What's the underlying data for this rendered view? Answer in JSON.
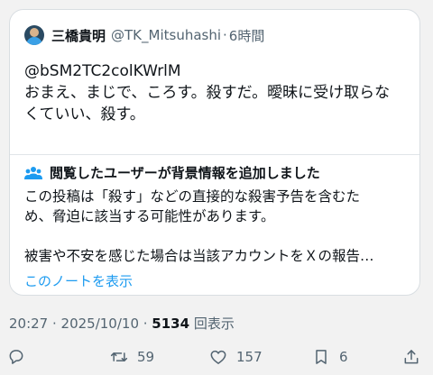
{
  "tweet": {
    "author_name": "三橋貴明",
    "author_handle": "@TK_Mitsuhashi",
    "separator": "·",
    "relative_time": "6時間",
    "body_lines": [
      "@bSM2TC2colKWrlM",
      "おまえ、まじで、ころす。殺すだ。曖昧に受け取らな",
      "くていい、殺す。"
    ]
  },
  "community_note": {
    "title": "閲覧したユーザーが背景情報を追加しました",
    "lines": [
      "この投稿は「殺す」などの直接的な殺害予告を含むた",
      "め、脅迫に該当する可能性があります。",
      "被害や不安を感じた場合は当該アカウントをＸの報告…"
    ],
    "show_note_link": "このノートを表示"
  },
  "meta": {
    "timestamp": "20:27 · 2025/10/10 · ",
    "views_count": "5134",
    "views_label": " 回表示"
  },
  "actions": {
    "reply_count": "",
    "retweet_count": "59",
    "like_count": "157",
    "bookmark_count": "6"
  },
  "colors": {
    "link": "#1d9bf0",
    "secondary_text": "#536471",
    "primary_text": "#0f1419"
  },
  "icons": [
    "avatar",
    "people-icon",
    "reply-icon",
    "retweet-icon",
    "like-icon",
    "bookmark-icon",
    "share-icon"
  ]
}
